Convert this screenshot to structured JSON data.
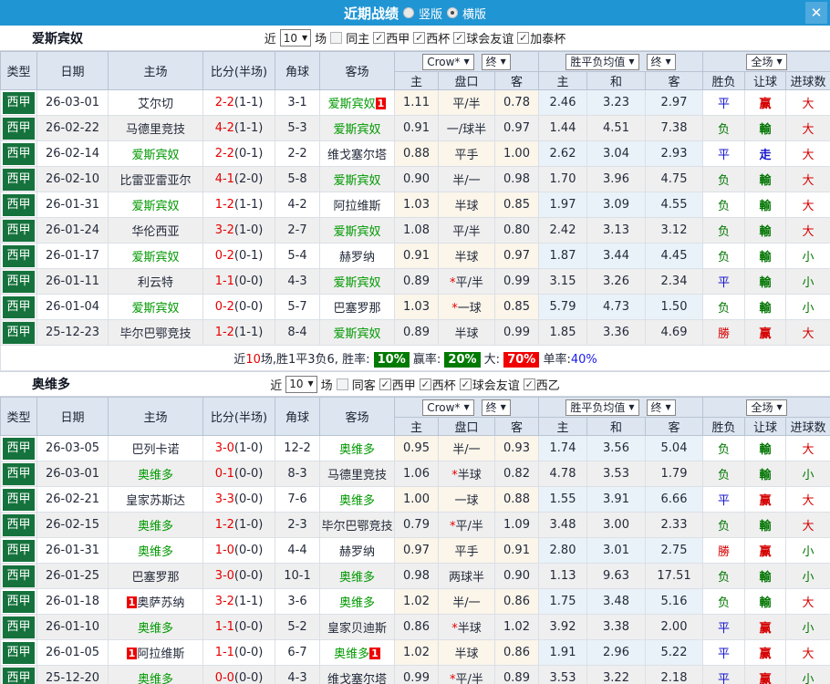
{
  "titlebar": {
    "title": "近期战绩",
    "vertical_label": "竖版",
    "horizontal_label": "横版",
    "close_glyph": "✕",
    "bar_color": "#2095d3"
  },
  "table": {
    "col_headers": {
      "type": "类型",
      "date": "日期",
      "home": "主场",
      "score": "比分(半场)",
      "corner": "角球",
      "away": "客场",
      "ah_home": "主",
      "ah_line": "盘口",
      "ah_away": "客",
      "eu_home": "主",
      "eu_draw": "和",
      "eu_away": "客",
      "res_wdl": "胜负",
      "res_ah": "让球",
      "res_ou": "进球数"
    },
    "dropdowns": {
      "bookmaker": "Crow*",
      "final1": "终",
      "odds_avg": "胜平负均值",
      "final2": "终",
      "scope": "全场"
    }
  },
  "result_colors": {
    "勝": "red",
    "胜": "red",
    "平": "blue",
    "负": "green",
    "赢": "red",
    "輸": "green",
    "走": "blue",
    "大": "red",
    "小": "green"
  },
  "status_colors": {
    "league_badge": "#15723c",
    "team_highlight": "#009900",
    "score": "#e60000",
    "rank_badge": "#ee0000"
  },
  "sections": [
    {
      "team": "爱斯宾奴",
      "filter": {
        "near": "近",
        "count": "10",
        "games": "场",
        "same_label": "同主",
        "leagues": [
          {
            "label": "西甲",
            "checked": true
          },
          {
            "label": "西杯",
            "checked": true
          },
          {
            "label": "球会友谊",
            "checked": true
          },
          {
            "label": "加泰杯",
            "checked": true
          }
        ]
      },
      "rows": [
        {
          "league": "西甲",
          "date": "26-03-01",
          "home": {
            "name": "艾尔切",
            "green": false,
            "pre": "",
            "post": ""
          },
          "score": "2-2",
          "half": "(1-1)",
          "corner": "3-1",
          "away": {
            "name": "爱斯宾奴",
            "green": true,
            "pre": "",
            "post": "1"
          },
          "ah": [
            "1.11",
            "平/半",
            "0.78"
          ],
          "eu": [
            "2.46",
            "3.23",
            "2.97"
          ],
          "res": [
            "平",
            "赢",
            "大"
          ]
        },
        {
          "league": "西甲",
          "date": "26-02-22",
          "home": {
            "name": "马德里竞技",
            "green": false,
            "pre": "",
            "post": ""
          },
          "score": "4-2",
          "half": "(1-1)",
          "corner": "5-3",
          "away": {
            "name": "爱斯宾奴",
            "green": true,
            "pre": "",
            "post": ""
          },
          "ah": [
            "0.91",
            "一/球半",
            "0.97"
          ],
          "eu": [
            "1.44",
            "4.51",
            "7.38"
          ],
          "res": [
            "负",
            "輸",
            "大"
          ]
        },
        {
          "league": "西甲",
          "date": "26-02-14",
          "home": {
            "name": "爱斯宾奴",
            "green": true,
            "pre": "",
            "post": ""
          },
          "score": "2-2",
          "half": "(0-1)",
          "corner": "2-2",
          "away": {
            "name": "维戈塞尔塔",
            "green": false,
            "pre": "",
            "post": ""
          },
          "ah": [
            "0.88",
            "平手",
            "1.00"
          ],
          "eu": [
            "2.62",
            "3.04",
            "2.93"
          ],
          "res": [
            "平",
            "走",
            "大"
          ]
        },
        {
          "league": "西甲",
          "date": "26-02-10",
          "home": {
            "name": "比雷亚雷亚尔",
            "green": false,
            "pre": "",
            "post": ""
          },
          "score": "4-1",
          "half": "(2-0)",
          "corner": "5-8",
          "away": {
            "name": "爱斯宾奴",
            "green": true,
            "pre": "",
            "post": ""
          },
          "ah": [
            "0.90",
            "半/一",
            "0.98"
          ],
          "eu": [
            "1.70",
            "3.96",
            "4.75"
          ],
          "res": [
            "负",
            "輸",
            "大"
          ]
        },
        {
          "league": "西甲",
          "date": "26-01-31",
          "home": {
            "name": "爱斯宾奴",
            "green": true,
            "pre": "",
            "post": ""
          },
          "score": "1-2",
          "half": "(1-1)",
          "corner": "4-2",
          "away": {
            "name": "阿拉维斯",
            "green": false,
            "pre": "",
            "post": ""
          },
          "ah": [
            "1.03",
            "半球",
            "0.85"
          ],
          "eu": [
            "1.97",
            "3.09",
            "4.55"
          ],
          "res": [
            "负",
            "輸",
            "大"
          ]
        },
        {
          "league": "西甲",
          "date": "26-01-24",
          "home": {
            "name": "华伦西亚",
            "green": false,
            "pre": "",
            "post": ""
          },
          "score": "3-2",
          "half": "(1-0)",
          "corner": "2-7",
          "away": {
            "name": "爱斯宾奴",
            "green": true,
            "pre": "",
            "post": ""
          },
          "ah": [
            "1.08",
            "平/半",
            "0.80"
          ],
          "eu": [
            "2.42",
            "3.13",
            "3.12"
          ],
          "res": [
            "负",
            "輸",
            "大"
          ]
        },
        {
          "league": "西甲",
          "date": "26-01-17",
          "home": {
            "name": "爱斯宾奴",
            "green": true,
            "pre": "",
            "post": ""
          },
          "score": "0-2",
          "half": "(0-1)",
          "corner": "5-4",
          "away": {
            "name": "赫罗纳",
            "green": false,
            "pre": "",
            "post": ""
          },
          "ah": [
            "0.91",
            "半球",
            "0.97"
          ],
          "eu": [
            "1.87",
            "3.44",
            "4.45"
          ],
          "res": [
            "负",
            "輸",
            "小"
          ]
        },
        {
          "league": "西甲",
          "date": "26-01-11",
          "home": {
            "name": "利云特",
            "green": false,
            "pre": "",
            "post": ""
          },
          "score": "1-1",
          "half": "(0-0)",
          "corner": "4-3",
          "away": {
            "name": "爱斯宾奴",
            "green": true,
            "pre": "",
            "post": ""
          },
          "ah": [
            "0.89",
            "*平/半",
            "0.99"
          ],
          "eu": [
            "3.15",
            "3.26",
            "2.34"
          ],
          "res": [
            "平",
            "輸",
            "小"
          ]
        },
        {
          "league": "西甲",
          "date": "26-01-04",
          "home": {
            "name": "爱斯宾奴",
            "green": true,
            "pre": "",
            "post": ""
          },
          "score": "0-2",
          "half": "(0-0)",
          "corner": "5-7",
          "away": {
            "name": "巴塞罗那",
            "green": false,
            "pre": "",
            "post": ""
          },
          "ah": [
            "1.03",
            "*一球",
            "0.85"
          ],
          "eu": [
            "5.79",
            "4.73",
            "1.50"
          ],
          "res": [
            "负",
            "輸",
            "小"
          ]
        },
        {
          "league": "西甲",
          "date": "25-12-23",
          "home": {
            "name": "毕尔巴鄂竞技",
            "green": false,
            "pre": "",
            "post": ""
          },
          "score": "1-2",
          "half": "(1-1)",
          "corner": "8-4",
          "away": {
            "name": "爱斯宾奴",
            "green": true,
            "pre": "",
            "post": ""
          },
          "ah": [
            "0.89",
            "半球",
            "0.99"
          ],
          "eu": [
            "1.85",
            "3.36",
            "4.69"
          ],
          "res": [
            "勝",
            "赢",
            "大"
          ]
        }
      ],
      "summary": {
        "prefix_a": "近",
        "prefix_num": "10",
        "prefix_b": "场,胜1平3负6, ",
        "win_label": "胜率:",
        "win_pct": "10%",
        "ah_label": "赢率:",
        "ah_pct": "20%",
        "ou_label": "大:",
        "ou_pct": "70%",
        "single_label": "单率:",
        "single_pct": "40%"
      }
    },
    {
      "team": "奥维多",
      "filter": {
        "near": "近",
        "count": "10",
        "games": "场",
        "same_label": "同客",
        "leagues": [
          {
            "label": "西甲",
            "checked": true
          },
          {
            "label": "西杯",
            "checked": true
          },
          {
            "label": "球会友谊",
            "checked": true
          },
          {
            "label": "西乙",
            "checked": true
          }
        ]
      },
      "rows": [
        {
          "league": "西甲",
          "date": "26-03-05",
          "home": {
            "name": "巴列卡诺",
            "green": false,
            "pre": "",
            "post": ""
          },
          "score": "3-0",
          "half": "(1-0)",
          "corner": "12-2",
          "away": {
            "name": "奥维多",
            "green": true,
            "pre": "",
            "post": ""
          },
          "ah": [
            "0.95",
            "半/一",
            "0.93"
          ],
          "eu": [
            "1.74",
            "3.56",
            "5.04"
          ],
          "res": [
            "负",
            "輸",
            "大"
          ]
        },
        {
          "league": "西甲",
          "date": "26-03-01",
          "home": {
            "name": "奥维多",
            "green": true,
            "pre": "",
            "post": ""
          },
          "score": "0-1",
          "half": "(0-0)",
          "corner": "8-3",
          "away": {
            "name": "马德里竞技",
            "green": false,
            "pre": "",
            "post": ""
          },
          "ah": [
            "1.06",
            "*半球",
            "0.82"
          ],
          "eu": [
            "4.78",
            "3.53",
            "1.79"
          ],
          "res": [
            "负",
            "輸",
            "小"
          ]
        },
        {
          "league": "西甲",
          "date": "26-02-21",
          "home": {
            "name": "皇家苏斯达",
            "green": false,
            "pre": "",
            "post": ""
          },
          "score": "3-3",
          "half": "(0-0)",
          "corner": "7-6",
          "away": {
            "name": "奥维多",
            "green": true,
            "pre": "",
            "post": ""
          },
          "ah": [
            "1.00",
            "一球",
            "0.88"
          ],
          "eu": [
            "1.55",
            "3.91",
            "6.66"
          ],
          "res": [
            "平",
            "赢",
            "大"
          ]
        },
        {
          "league": "西甲",
          "date": "26-02-15",
          "home": {
            "name": "奥维多",
            "green": true,
            "pre": "",
            "post": ""
          },
          "score": "1-2",
          "half": "(1-0)",
          "corner": "2-3",
          "away": {
            "name": "毕尔巴鄂竞技",
            "green": false,
            "pre": "",
            "post": ""
          },
          "ah": [
            "0.79",
            "*平/半",
            "1.09"
          ],
          "eu": [
            "3.48",
            "3.00",
            "2.33"
          ],
          "res": [
            "负",
            "輸",
            "大"
          ]
        },
        {
          "league": "西甲",
          "date": "26-01-31",
          "home": {
            "name": "奥维多",
            "green": true,
            "pre": "",
            "post": ""
          },
          "score": "1-0",
          "half": "(0-0)",
          "corner": "4-4",
          "away": {
            "name": "赫罗纳",
            "green": false,
            "pre": "",
            "post": ""
          },
          "ah": [
            "0.97",
            "平手",
            "0.91"
          ],
          "eu": [
            "2.80",
            "3.01",
            "2.75"
          ],
          "res": [
            "勝",
            "赢",
            "小"
          ]
        },
        {
          "league": "西甲",
          "date": "26-01-25",
          "home": {
            "name": "巴塞罗那",
            "green": false,
            "pre": "",
            "post": ""
          },
          "score": "3-0",
          "half": "(0-0)",
          "corner": "10-1",
          "away": {
            "name": "奥维多",
            "green": true,
            "pre": "",
            "post": ""
          },
          "ah": [
            "0.98",
            "两球半",
            "0.90"
          ],
          "eu": [
            "1.13",
            "9.63",
            "17.51"
          ],
          "res": [
            "负",
            "輸",
            "小"
          ]
        },
        {
          "league": "西甲",
          "date": "26-01-18",
          "home": {
            "name": "奥萨苏纳",
            "green": false,
            "pre": "1",
            "post": ""
          },
          "score": "3-2",
          "half": "(1-1)",
          "corner": "3-6",
          "away": {
            "name": "奥维多",
            "green": true,
            "pre": "",
            "post": ""
          },
          "ah": [
            "1.02",
            "半/一",
            "0.86"
          ],
          "eu": [
            "1.75",
            "3.48",
            "5.16"
          ],
          "res": [
            "负",
            "輸",
            "大"
          ]
        },
        {
          "league": "西甲",
          "date": "26-01-10",
          "home": {
            "name": "奥维多",
            "green": true,
            "pre": "",
            "post": ""
          },
          "score": "1-1",
          "half": "(0-0)",
          "corner": "5-2",
          "away": {
            "name": "皇家贝迪斯",
            "green": false,
            "pre": "",
            "post": ""
          },
          "ah": [
            "0.86",
            "*半球",
            "1.02"
          ],
          "eu": [
            "3.92",
            "3.38",
            "2.00"
          ],
          "res": [
            "平",
            "赢",
            "小"
          ]
        },
        {
          "league": "西甲",
          "date": "26-01-05",
          "home": {
            "name": "阿拉维斯",
            "green": false,
            "pre": "1",
            "post": ""
          },
          "score": "1-1",
          "half": "(0-0)",
          "corner": "6-7",
          "away": {
            "name": "奥维多",
            "green": true,
            "pre": "",
            "post": "1"
          },
          "ah": [
            "1.02",
            "半球",
            "0.86"
          ],
          "eu": [
            "1.91",
            "2.96",
            "5.22"
          ],
          "res": [
            "平",
            "赢",
            "大"
          ]
        },
        {
          "league": "西甲",
          "date": "25-12-20",
          "home": {
            "name": "奥维多",
            "green": true,
            "pre": "",
            "post": ""
          },
          "score": "0-0",
          "half": "(0-0)",
          "corner": "4-3",
          "away": {
            "name": "维戈塞尔塔",
            "green": false,
            "pre": "",
            "post": ""
          },
          "ah": [
            "0.99",
            "*平/半",
            "0.89"
          ],
          "eu": [
            "3.53",
            "3.22",
            "2.18"
          ],
          "res": [
            "平",
            "赢",
            "小"
          ]
        }
      ]
    }
  ]
}
